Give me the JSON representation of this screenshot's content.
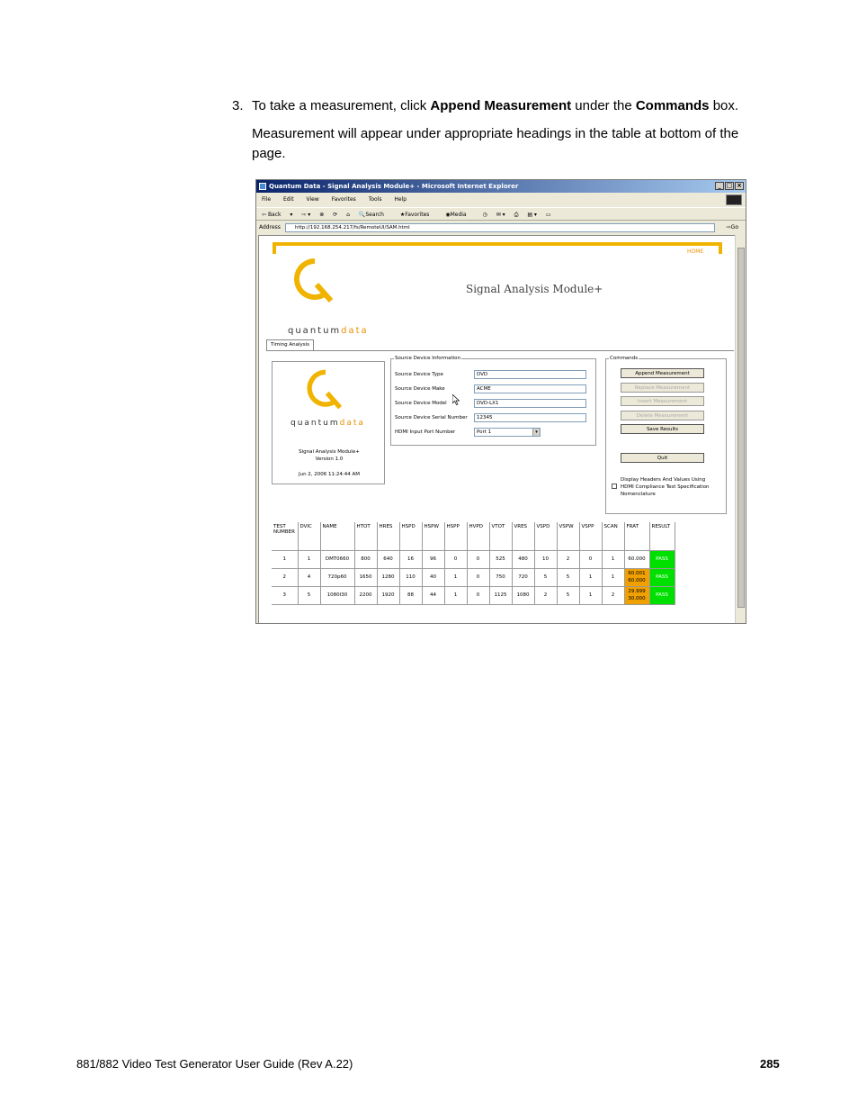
{
  "step": {
    "number": "3.",
    "prefix": "To take a measurement, click ",
    "bold1": "Append Measurement",
    "mid": " under the ",
    "bold2": "Commands",
    "suffix": " box."
  },
  "paragraph": "Measurement will appear under appropriate headings in the table at bottom of the page.",
  "window": {
    "title": "Quantum Data - Signal Analysis Module+ - Microsoft Internet Explorer",
    "menu": [
      "File",
      "Edit",
      "View",
      "Favorites",
      "Tools",
      "Help"
    ],
    "toolbar": [
      "Back",
      "Search",
      "Favorites",
      "Media"
    ],
    "address_label": "Address",
    "address": "http://192.168.254.217/fs/RemoteUI/SAM.html",
    "go_label": "Go"
  },
  "page": {
    "home_link": "HOME",
    "logo_word": "quantum",
    "logo_word2": "data",
    "title": "Signal Analysis Module+",
    "tab": "Timing Analysis",
    "info": {
      "product": "Signal Analysis Module+",
      "version": "Version 1.0",
      "date": "Jun 2, 2006 11:24:44 AM"
    },
    "source": {
      "legend": "Source Device Information",
      "fields": [
        {
          "label": "Source Device Type",
          "value": "DVD"
        },
        {
          "label": "Source Device Make",
          "value": "ACME"
        },
        {
          "label": "Source Device Model",
          "value": "DVD-LX1"
        },
        {
          "label": "Source Device Serial Number",
          "value": "12345"
        }
      ],
      "port_label": "HDMI Input Port Number",
      "port_value": "Port 1"
    },
    "commands": {
      "legend": "Commands",
      "append": "Append Measurement",
      "replace": "Replace Measurement",
      "insert": "Insert Measurement",
      "delete": "Delete Measurement",
      "save": "Save Results",
      "quit": "Quit",
      "checkbox_label": "Display Headers And Values Using HDMI Compliance Test Specification Nomenclature"
    },
    "table": {
      "headers": [
        "TEST NUMBER",
        "DVIC",
        "NAME",
        "HTOT",
        "HRES",
        "HSPD",
        "HSPW",
        "HSPP",
        "HVPD",
        "VTOT",
        "VRES",
        "VSPD",
        "VSPW",
        "VSPP",
        "SCAN",
        "FRAT",
        "RESULT"
      ],
      "rows": [
        [
          "1",
          "1",
          "DMT0660",
          "800",
          "640",
          "16",
          "96",
          "0",
          "0",
          "525",
          "480",
          "10",
          "2",
          "0",
          "1",
          "60.000",
          "PASS"
        ],
        [
          "2",
          "4",
          "720p60",
          "1650",
          "1280",
          "110",
          "40",
          "1",
          "0",
          "750",
          "720",
          "5",
          "5",
          "1",
          "1",
          "60.001 60.000",
          "PASS"
        ],
        [
          "3",
          "5",
          "1080I30",
          "2200",
          "1920",
          "88",
          "44",
          "1",
          "0",
          "1125",
          "1080",
          "2",
          "5",
          "1",
          "2",
          "29.999 30.000",
          "PASS"
        ]
      ]
    }
  },
  "footer": {
    "left": "881/882 Video Test Generator User Guide (Rev A.22)",
    "page": "285"
  },
  "colors": {
    "accent": "#f0b400",
    "pass": "#00e000",
    "warn": "#f0a000"
  }
}
